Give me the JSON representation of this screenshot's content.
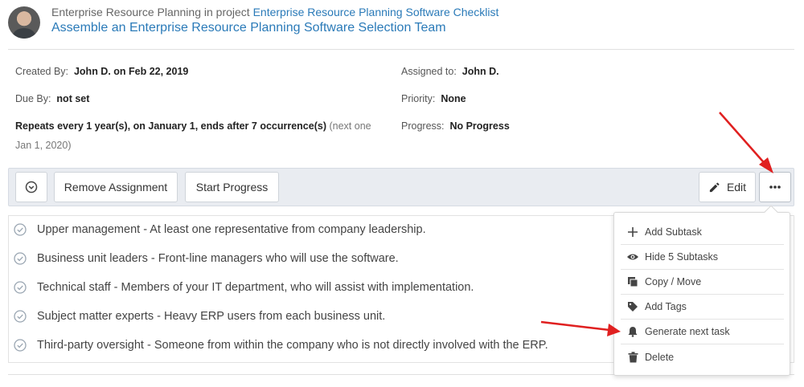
{
  "header": {
    "breadcrumb_prefix": "Enterprise Resource Planning in project",
    "breadcrumb_link": "Enterprise Resource Planning Software Checklist",
    "title": "Assemble an Enterprise Resource Planning Software Selection Team"
  },
  "details": {
    "created_by_label": "Created By:",
    "created_by_value": "John D. on Feb 22, 2019",
    "assigned_label": "Assigned to:",
    "assigned_value": "John D.",
    "due_label": "Due By:",
    "due_value": "not set",
    "priority_label": "Priority:",
    "priority_value": "None",
    "repeats_value": "Repeats every 1 year(s), on January 1, ends after 7 occurrence(s)",
    "repeats_next": "(next one",
    "repeats_next_date": "Jan 1, 2020)",
    "progress_label": "Progress:",
    "progress_value": "No Progress"
  },
  "toolbar": {
    "remove_assignment": "Remove Assignment",
    "start_progress": "Start Progress",
    "edit": "Edit"
  },
  "subtasks": [
    {
      "title": "Upper management",
      "desc": " - At least one representative from company leadership."
    },
    {
      "title": "Business unit leaders",
      "desc": " - Front-line managers who will use the software."
    },
    {
      "title": "Technical staff",
      "desc": " - Members of your IT department, who will assist with implementation."
    },
    {
      "title": "Subject matter experts",
      "desc": " - Heavy ERP users from each business unit."
    },
    {
      "title": "Third-party oversight",
      "desc": " - Someone from within the company who is not directly involved with the ERP."
    }
  ],
  "menu": {
    "items": [
      {
        "label": "Add Subtask",
        "icon": "plus-icon"
      },
      {
        "label": "Hide 5 Subtasks",
        "icon": "eye-icon"
      },
      {
        "label": "Copy / Move",
        "icon": "copy-icon"
      },
      {
        "label": "Add Tags",
        "icon": "tag-icon"
      },
      {
        "label": "Generate next task",
        "icon": "bell-icon"
      },
      {
        "label": "Delete",
        "icon": "trash-icon"
      }
    ]
  },
  "colors": {
    "link": "#2a7ab8",
    "toolbar_bg": "#e9ecf1",
    "annotation_arrow": "#e02020"
  }
}
